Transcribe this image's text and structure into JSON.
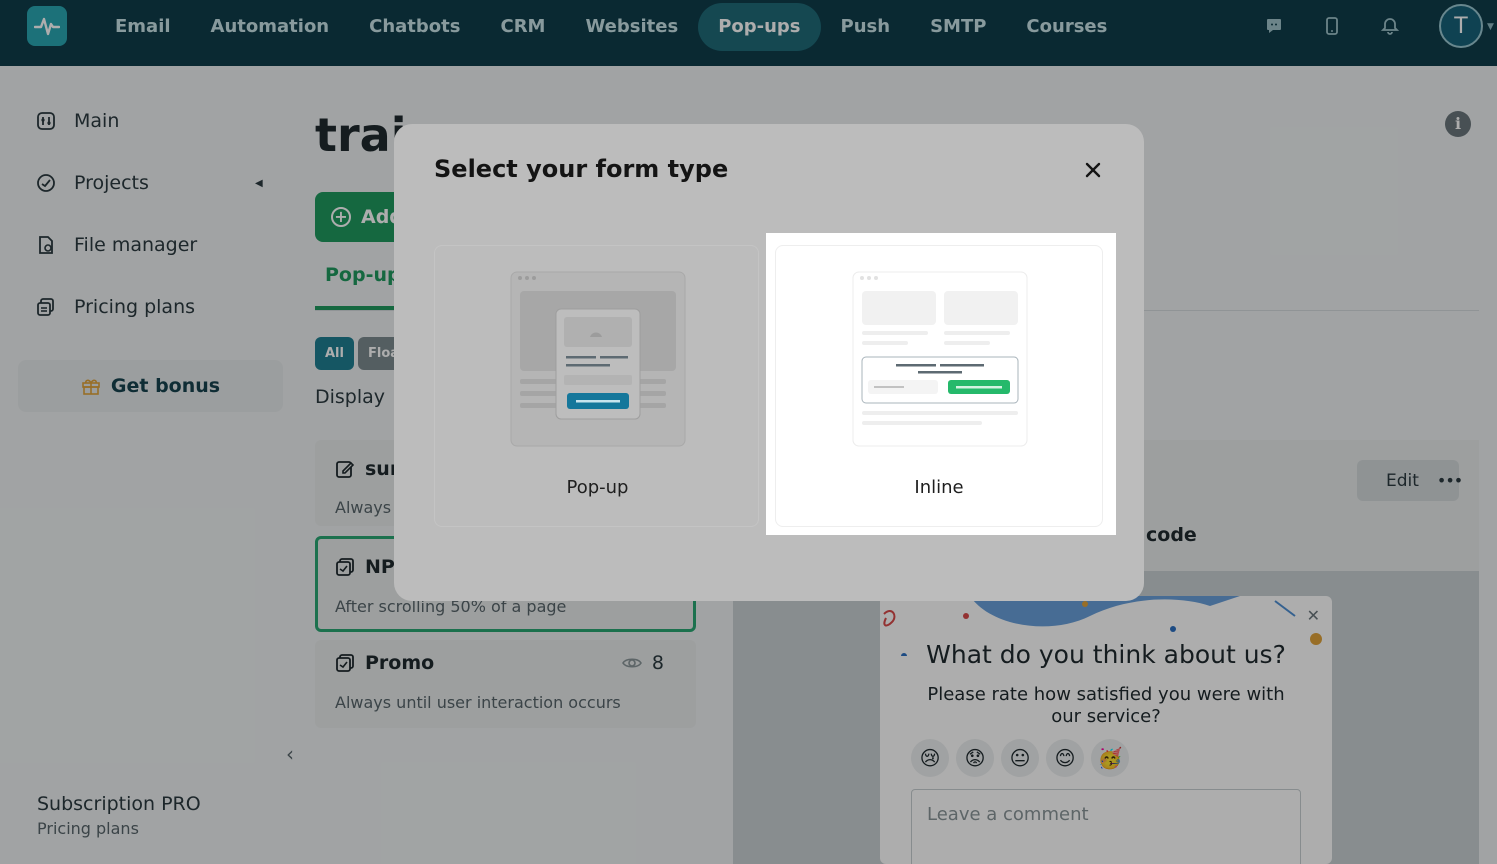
{
  "nav": {
    "items": [
      {
        "label": "Email",
        "active": false
      },
      {
        "label": "Automation",
        "active": false
      },
      {
        "label": "Chatbots",
        "active": false
      },
      {
        "label": "CRM",
        "active": false
      },
      {
        "label": "Websites",
        "active": false
      },
      {
        "label": "Pop-ups",
        "active": true
      },
      {
        "label": "Push",
        "active": false
      },
      {
        "label": "SMTP",
        "active": false
      },
      {
        "label": "Courses",
        "active": false
      }
    ],
    "icons": [
      "chat-icon",
      "mobile-icon",
      "bell-icon"
    ],
    "avatar_initial": "T"
  },
  "sidebar": {
    "items": [
      {
        "label": "Main",
        "icon": "dashboard-icon"
      },
      {
        "label": "Projects",
        "icon": "projects-icon"
      },
      {
        "label": "File manager",
        "icon": "file-manager-icon"
      },
      {
        "label": "Pricing plans",
        "icon": "pricing-icon"
      }
    ],
    "bonus_label": "Get bonus",
    "subscription_title": "Subscription PRO",
    "subscription_link": "Pricing plans"
  },
  "main": {
    "title": "trai",
    "add_label": "Add",
    "tab_label": "Pop-up",
    "chips": [
      "All",
      "Floa"
    ],
    "display_label": "Display",
    "cards": [
      {
        "title": "sur",
        "subtitle": "Always"
      },
      {
        "title": "NP",
        "subtitle": "After scrolling 50% of a page"
      },
      {
        "title": "Promo",
        "subtitle": "Always until user interaction occurs",
        "views": "8"
      }
    ],
    "edit_label": "Edit",
    "code_label": "code"
  },
  "survey": {
    "question": "What do you think about us?",
    "rate_text": "Please rate how satisfied you were with our service?",
    "comment_placeholder": "Leave a comment",
    "faces": [
      "😢",
      "😟",
      "😐",
      "😊",
      "🥳"
    ]
  },
  "modal": {
    "title": "Select your form type",
    "options": [
      {
        "label": "Pop-up",
        "selected": false
      },
      {
        "label": "Inline",
        "selected": true
      }
    ]
  },
  "colors": {
    "nav_bg": "#0f3d4a",
    "accent_green": "#1f9a5f",
    "accent_teal": "#1f7f92"
  }
}
